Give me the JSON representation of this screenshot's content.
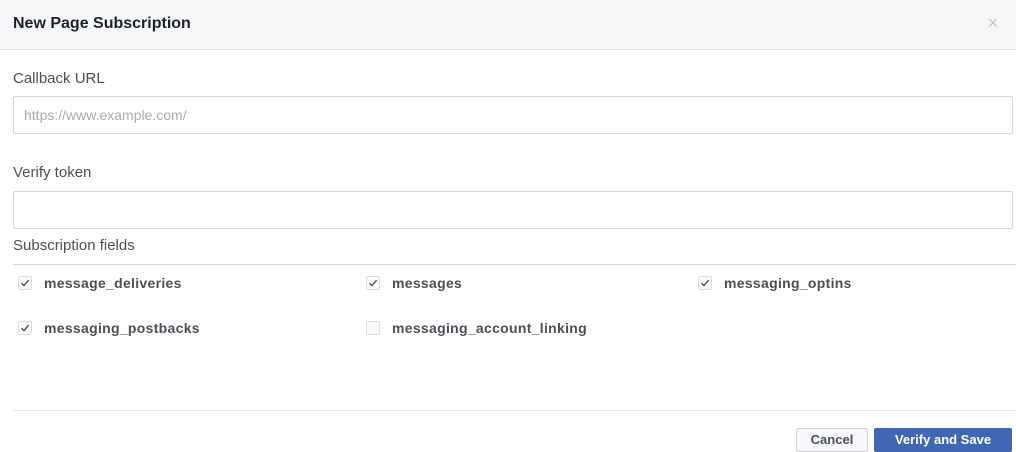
{
  "dialog": {
    "title": "New Page Subscription",
    "close_icon": "close-icon"
  },
  "callback_url": {
    "label": "Callback URL",
    "value": "",
    "placeholder": "https://www.example.com/"
  },
  "verify_token": {
    "label": "Verify token",
    "value": "",
    "placeholder": ""
  },
  "subscription_fields": {
    "label": "Subscription fields",
    "items": [
      {
        "label": "message_deliveries",
        "checked": true
      },
      {
        "label": "messages",
        "checked": true
      },
      {
        "label": "messaging_optins",
        "checked": true
      },
      {
        "label": "messaging_postbacks",
        "checked": true
      },
      {
        "label": "messaging_account_linking",
        "checked": false
      }
    ]
  },
  "footer": {
    "cancel_label": "Cancel",
    "submit_label": "Verify and Save"
  },
  "colors": {
    "primary": "#4267b2",
    "header_bg": "#f6f7f9"
  }
}
